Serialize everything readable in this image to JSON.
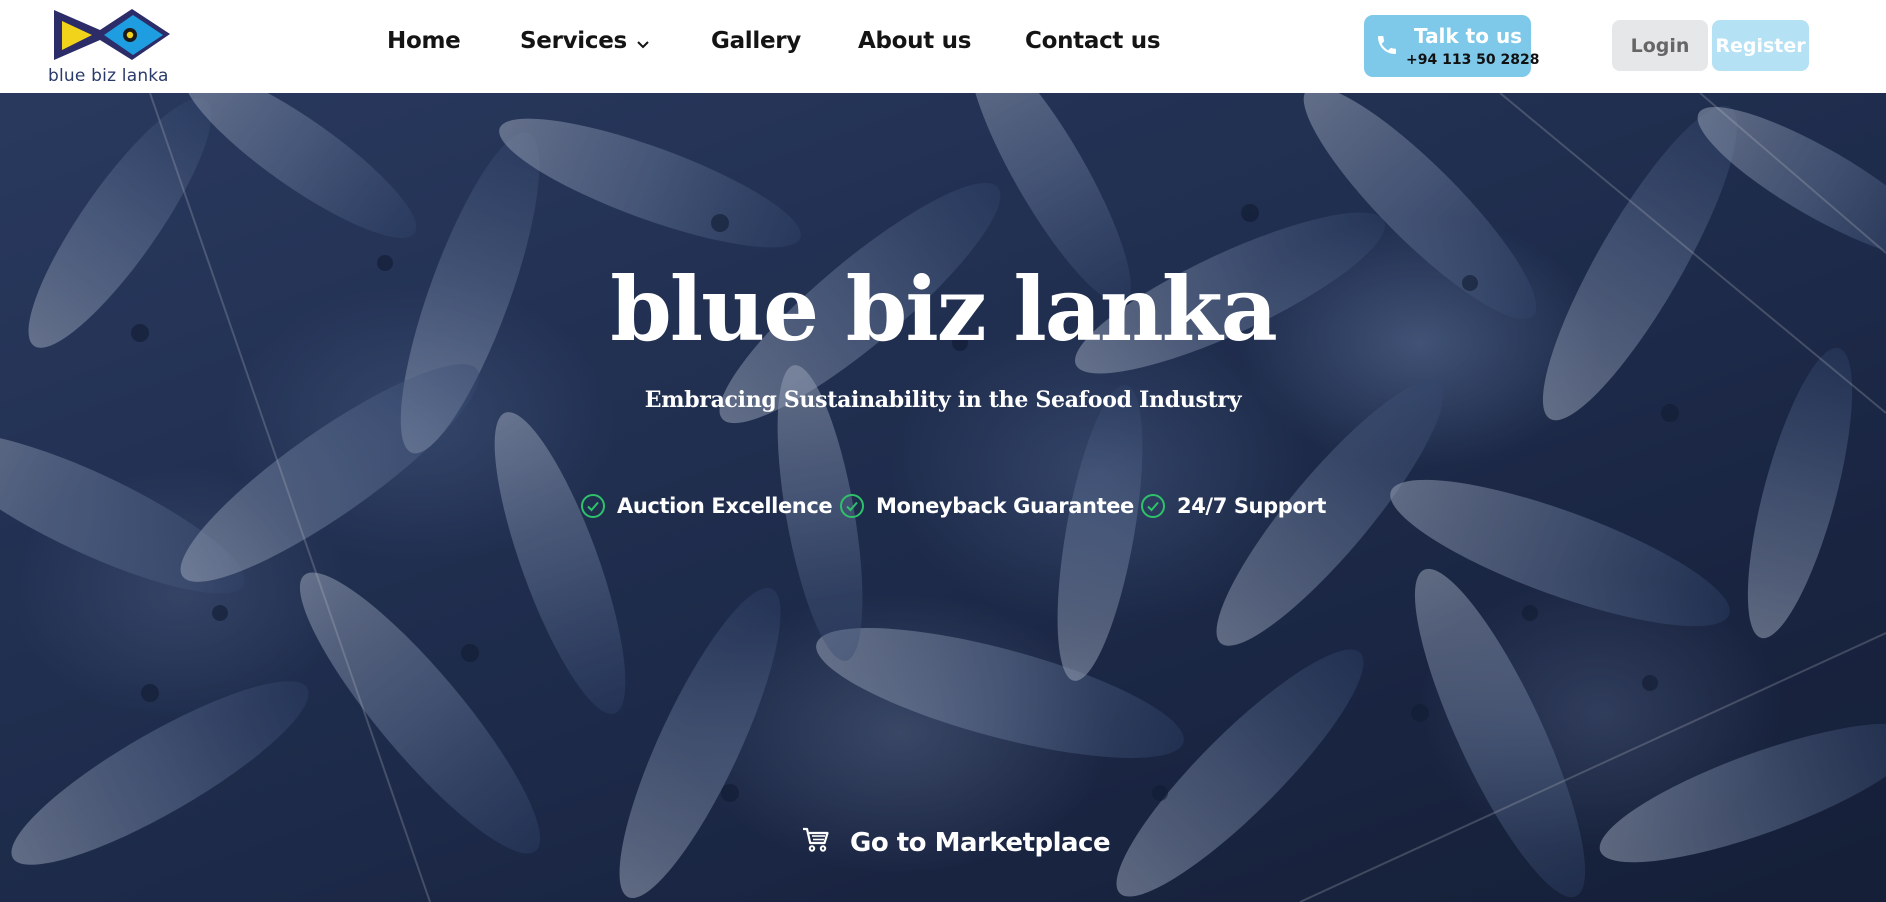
{
  "header": {
    "logo_text": "blue biz lanka",
    "logo_icon": "fish-logo",
    "nav": [
      {
        "label": "Home"
      },
      {
        "label": "Services",
        "has_dropdown": true
      },
      {
        "label": "Gallery"
      },
      {
        "label": "About us"
      },
      {
        "label": "Contact us"
      }
    ],
    "talk": {
      "title": "Talk to us",
      "phone": "+94 113 50 2828",
      "icon": "phone-icon"
    },
    "login_label": "Login",
    "register_label": "Register"
  },
  "hero": {
    "title": "blue biz lanka",
    "subtitle": "Embracing Sustainability in the Seafood Industry",
    "features": [
      {
        "label": "Auction Excellence",
        "icon": "check-circle-icon"
      },
      {
        "label": "Moneyback Guarantee",
        "icon": "check-circle-icon"
      },
      {
        "label": "24/7 Support",
        "icon": "check-circle-icon"
      }
    ],
    "cta_label": "Go to Marketplace",
    "cta_icon": "cart-icon",
    "background": "fish-catch-photo"
  },
  "colors": {
    "brand_navy": "#2a2f6b",
    "brand_blue": "#1e9ee0",
    "brand_yellow": "#f2d31c",
    "talk_button": "#7ec8ea",
    "register_button": "#b5e1f4",
    "login_button": "#e5e7e9",
    "check_green": "#2ec26a"
  }
}
